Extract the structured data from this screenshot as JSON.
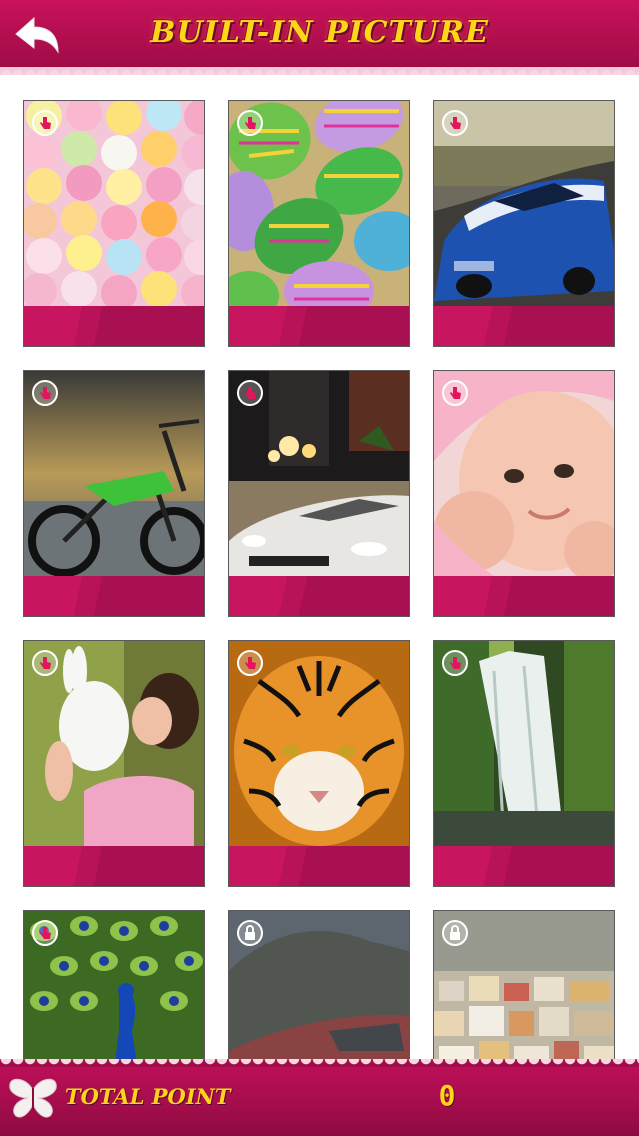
{
  "header": {
    "title": "Built-in picture",
    "back_icon": "back-arrow-icon"
  },
  "colors": {
    "brand": "#b00e4e",
    "accent": "#ffd51a",
    "tile_bar": "#c8155f"
  },
  "tiles": [
    {
      "name": "candy",
      "status": "unlocked",
      "badge_icon": "hand-tap-icon"
    },
    {
      "name": "easter-eggs",
      "status": "unlocked",
      "badge_icon": "hand-tap-icon"
    },
    {
      "name": "blue-car",
      "status": "unlocked",
      "badge_icon": "hand-tap-icon"
    },
    {
      "name": "motorbike",
      "status": "unlocked",
      "badge_icon": "hand-tap-icon"
    },
    {
      "name": "white-car",
      "status": "unlocked",
      "badge_icon": "hand-tap-icon"
    },
    {
      "name": "baby",
      "status": "unlocked",
      "badge_icon": "hand-tap-icon"
    },
    {
      "name": "girl-rabbit",
      "status": "unlocked",
      "badge_icon": "hand-tap-icon"
    },
    {
      "name": "tiger",
      "status": "unlocked",
      "badge_icon": "hand-tap-icon"
    },
    {
      "name": "waterfall",
      "status": "unlocked",
      "badge_icon": "hand-tap-icon"
    },
    {
      "name": "peacock",
      "status": "unlocked",
      "badge_icon": "hand-tap-icon"
    },
    {
      "name": "red-car-mountain",
      "status": "locked",
      "badge_icon": "lock-icon"
    },
    {
      "name": "town",
      "status": "locked",
      "badge_icon": "lock-icon"
    }
  ],
  "footer": {
    "label": "Total Point",
    "value": "0",
    "logo_icon": "butterfly-icon"
  }
}
